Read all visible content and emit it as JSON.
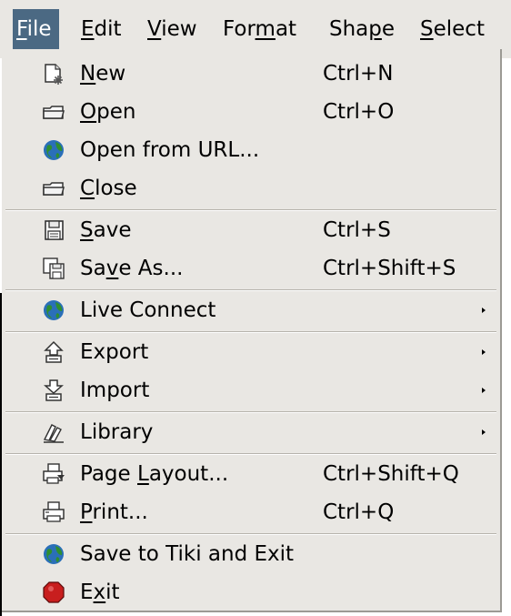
{
  "menubar": {
    "items": [
      {
        "pre": "",
        "key": "F",
        "post": "ile",
        "active": true
      },
      {
        "pre": "",
        "key": "E",
        "post": "dit"
      },
      {
        "pre": "",
        "key": "V",
        "post": "iew"
      },
      {
        "pre": "For",
        "key": "m",
        "post": "at"
      },
      {
        "pre": "Sha",
        "key": "p",
        "post": "e"
      },
      {
        "pre": "",
        "key": "S",
        "post": "elect"
      }
    ]
  },
  "file_menu": {
    "items": [
      {
        "pre": "",
        "key": "N",
        "post": "ew",
        "accel": "Ctrl+N",
        "icon": "new-file-icon"
      },
      {
        "pre": "",
        "key": "O",
        "post": "pen",
        "accel": "Ctrl+O",
        "icon": "folder-icon"
      },
      {
        "pre": "Open from URL...",
        "key": "",
        "post": "",
        "accel": "",
        "icon": "globe-icon"
      },
      {
        "pre": "",
        "key": "C",
        "post": "lose",
        "accel": "",
        "icon": "folder-icon"
      },
      {
        "pre": "",
        "key": "S",
        "post": "ave",
        "accel": "Ctrl+S",
        "icon": "floppy-icon"
      },
      {
        "pre": "Sa",
        "key": "v",
        "post": "e As...",
        "accel": "Ctrl+Shift+S",
        "icon": "floppy-multi-icon"
      },
      {
        "pre": "Live Connect",
        "key": "",
        "post": "",
        "accel": "",
        "icon": "globe-icon",
        "submenu": true
      },
      {
        "pre": "Export",
        "key": "",
        "post": "",
        "accel": "",
        "icon": "export-icon",
        "submenu": true
      },
      {
        "pre": "Import",
        "key": "",
        "post": "",
        "accel": "",
        "icon": "import-icon",
        "submenu": true
      },
      {
        "pre": "Library",
        "key": "",
        "post": "",
        "accel": "",
        "icon": "library-icon",
        "submenu": true
      },
      {
        "pre": "Page ",
        "key": "L",
        "post": "ayout...",
        "accel": "Ctrl+Shift+Q",
        "icon": "page-layout-icon"
      },
      {
        "pre": "",
        "key": "P",
        "post": "rint...",
        "accel": "Ctrl+Q",
        "icon": "printer-icon"
      },
      {
        "pre": "Save to Tiki and Exit",
        "key": "",
        "post": "",
        "accel": "",
        "icon": "globe-icon"
      },
      {
        "pre": "E",
        "key": "x",
        "post": "it",
        "accel": "",
        "icon": "stop-icon"
      }
    ]
  },
  "colors": {
    "menu_background": "#e9e7e3",
    "active_highlight": "#4b6983",
    "separator": "#b6b3ac"
  }
}
